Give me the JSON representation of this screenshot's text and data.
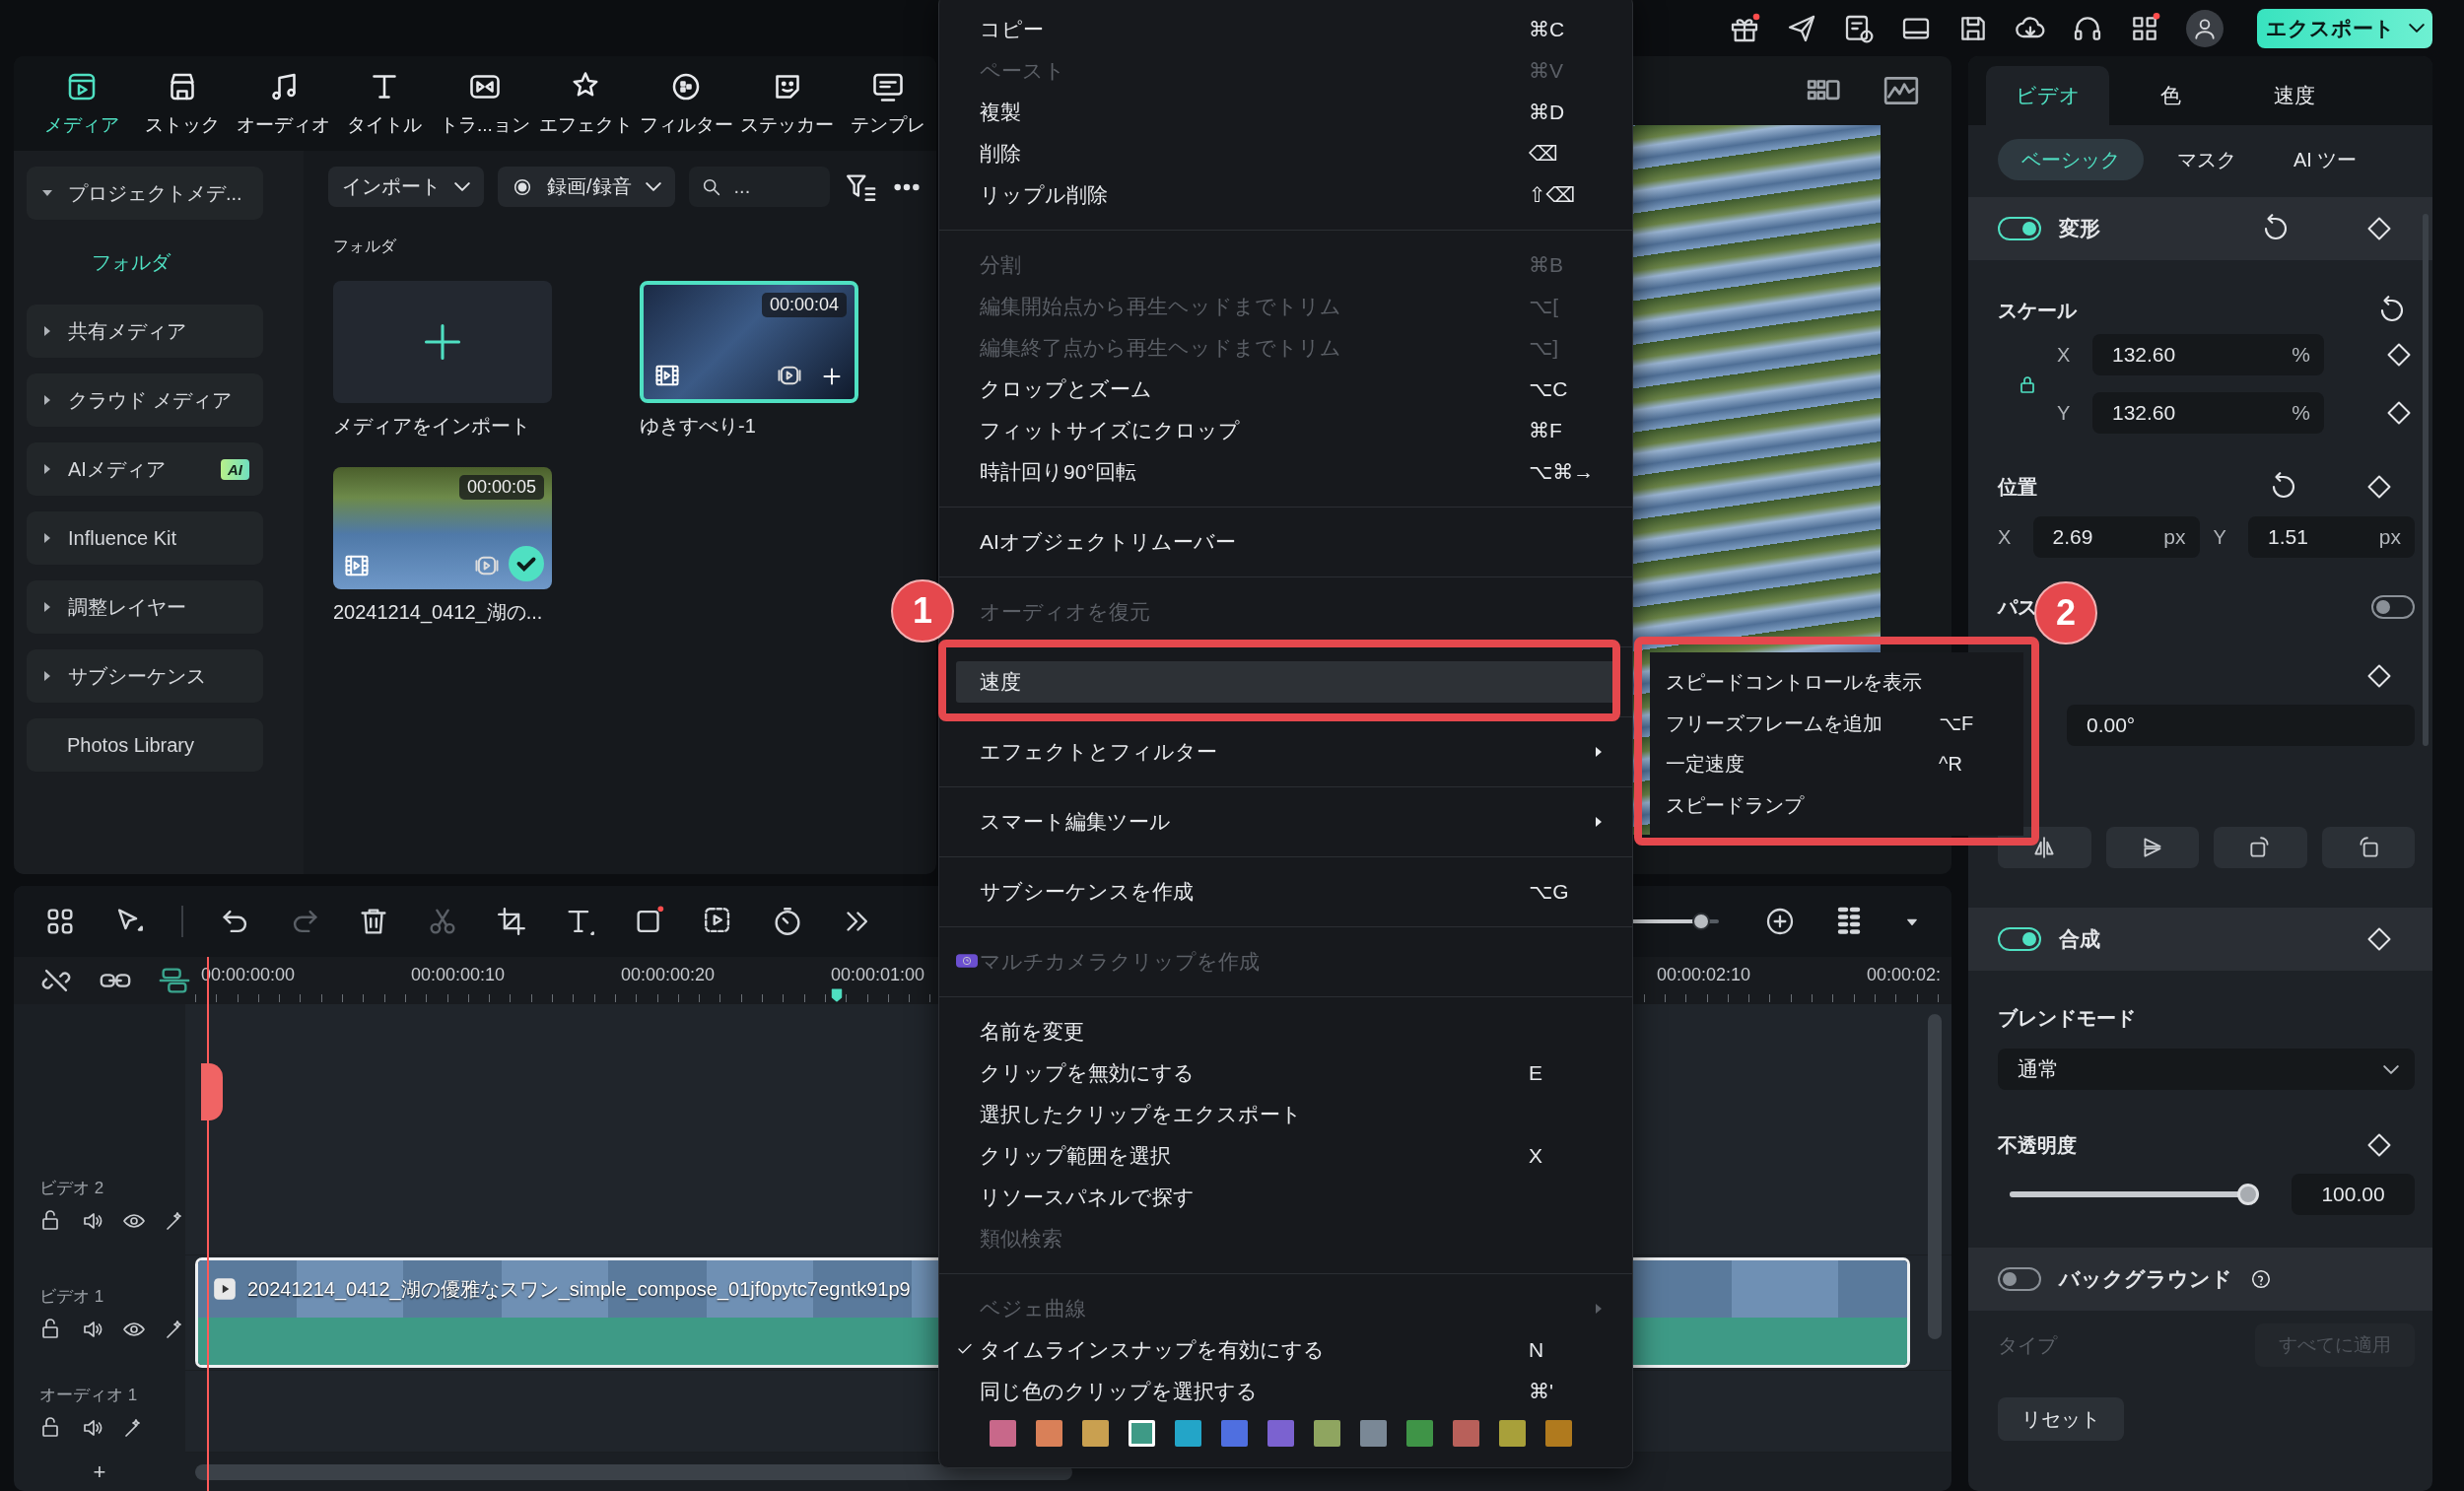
{
  "topbar": {
    "export_label": "エクスポート"
  },
  "media_tabs": [
    {
      "label": "メディア",
      "selected": true
    },
    {
      "label": "ストック",
      "selected": false
    },
    {
      "label": "オーディオ",
      "selected": false
    },
    {
      "label": "タイトル",
      "selected": false
    },
    {
      "label": "トラ...ョン",
      "selected": false
    },
    {
      "label": "エフェクト",
      "selected": false
    },
    {
      "label": "フィルター",
      "selected": false
    },
    {
      "label": "ステッカー",
      "selected": false
    },
    {
      "label": "テンプレ",
      "selected": false
    }
  ],
  "sidebar": {
    "items": [
      {
        "label": "プロジェクトメデ...",
        "kind": "expandable",
        "expanded": true,
        "selected": false,
        "children": [
          {
            "label": "フォルダ",
            "kind": "folder",
            "selected": true
          }
        ]
      },
      {
        "label": "共有メディア",
        "kind": "expandable",
        "expanded": false,
        "selected": false
      },
      {
        "label": "クラウド メディア",
        "kind": "expandable",
        "expanded": false,
        "selected": false
      },
      {
        "label": "AIメディア",
        "kind": "expandable",
        "expanded": false,
        "selected": false,
        "badge": "AI"
      },
      {
        "label": "Influence Kit",
        "kind": "expandable",
        "expanded": false,
        "selected": false
      },
      {
        "label": "調整レイヤー",
        "kind": "expandable",
        "expanded": false,
        "selected": false
      },
      {
        "label": "サブシーケンス",
        "kind": "expandable",
        "expanded": false,
        "selected": false
      },
      {
        "label": "Photos Library",
        "kind": "plain",
        "selected": false
      }
    ]
  },
  "media_toolbar": {
    "import_label": "インポート",
    "record_label": "録画/録音",
    "search_placeholder": "..."
  },
  "media": {
    "folder_label": "フォルダ",
    "items": [
      {
        "kind": "import",
        "label": "メディアをインポート",
        "selected": false
      },
      {
        "kind": "clip",
        "label": "ゆきすべり-1",
        "duration": "00:00:04",
        "selected": true,
        "used": false
      },
      {
        "kind": "clip",
        "label": "20241214_0412_湖の...",
        "duration": "00:00:05",
        "selected": false,
        "used": true
      }
    ]
  },
  "menu": {
    "groups": [
      {
        "items": [
          {
            "kind": "text",
            "label": "コピー",
            "shortcut": "⌘C",
            "disabled": false,
            "selected": false,
            "checked": false,
            "submenu": false
          },
          {
            "kind": "text",
            "label": "ペースト",
            "shortcut": "⌘V",
            "disabled": true,
            "selected": false,
            "checked": false,
            "submenu": false
          },
          {
            "kind": "text",
            "label": "複製",
            "shortcut": "⌘D",
            "disabled": false,
            "selected": false,
            "checked": false,
            "submenu": false
          },
          {
            "kind": "text",
            "label": "削除",
            "shortcut": "⌫",
            "disabled": false,
            "selected": false,
            "checked": false,
            "submenu": false
          },
          {
            "kind": "text",
            "label": "リップル削除",
            "shortcut": "⇧⌫",
            "disabled": false,
            "selected": false,
            "checked": false,
            "submenu": false
          }
        ]
      },
      {
        "items": [
          {
            "kind": "text",
            "label": "分割",
            "shortcut": "⌘B",
            "disabled": true,
            "selected": false,
            "checked": false,
            "submenu": false
          },
          {
            "kind": "text",
            "label": "編集開始点から再生ヘッドまでトリム",
            "shortcut": "⌥[",
            "disabled": true,
            "selected": false,
            "checked": false,
            "submenu": false
          },
          {
            "kind": "text",
            "label": "編集終了点から再生ヘッドまでトリム",
            "shortcut": "⌥]",
            "disabled": true,
            "selected": false,
            "checked": false,
            "submenu": false
          },
          {
            "kind": "text",
            "label": "クロップとズーム",
            "shortcut": "⌥C",
            "disabled": false,
            "selected": false,
            "checked": false,
            "submenu": false
          },
          {
            "kind": "text",
            "label": "フィットサイズにクロップ",
            "shortcut": "⌘F",
            "disabled": false,
            "selected": false,
            "checked": false,
            "submenu": false
          },
          {
            "kind": "text",
            "label": "時計回り90°回転",
            "shortcut": "⌥⌘→",
            "disabled": false,
            "selected": false,
            "checked": false,
            "submenu": false
          }
        ]
      },
      {
        "items": [
          {
            "kind": "text",
            "label": "AIオブジェクトリムーバー",
            "disabled": false,
            "selected": false,
            "checked": false,
            "submenu": false
          }
        ]
      },
      {
        "items": [
          {
            "kind": "text",
            "label": "オーディオを復元",
            "disabled": true,
            "selected": false,
            "checked": false,
            "submenu": false
          }
        ]
      },
      {
        "items": [
          {
            "kind": "text",
            "label": "速度",
            "disabled": false,
            "selected": true,
            "checked": false,
            "submenu": false
          }
        ]
      },
      {
        "items": [
          {
            "kind": "text",
            "label": "エフェクトとフィルター",
            "disabled": false,
            "selected": false,
            "checked": false,
            "submenu": true
          }
        ]
      },
      {
        "items": [
          {
            "kind": "text",
            "label": "スマート編集ツール",
            "disabled": false,
            "selected": false,
            "checked": false,
            "submenu": true
          }
        ]
      },
      {
        "items": [
          {
            "kind": "text",
            "label": "サブシーケンスを作成",
            "shortcut": "⌥G",
            "disabled": false,
            "selected": false,
            "checked": false,
            "submenu": false
          }
        ]
      },
      {
        "items": [
          {
            "kind": "camera",
            "label": "マルチカメラクリップを作成",
            "disabled": true,
            "selected": false,
            "checked": false,
            "submenu": false
          }
        ]
      },
      {
        "items": [
          {
            "kind": "text",
            "label": "名前を変更",
            "disabled": false,
            "selected": false,
            "checked": false,
            "submenu": false
          },
          {
            "kind": "text",
            "label": "クリップを無効にする",
            "shortcut": "E",
            "disabled": false,
            "selected": false,
            "checked": false,
            "submenu": false
          },
          {
            "kind": "text",
            "label": "選択したクリップをエクスポート",
            "disabled": false,
            "selected": false,
            "checked": false,
            "submenu": false
          },
          {
            "kind": "text",
            "label": "クリップ範囲を選択",
            "shortcut": "X",
            "disabled": false,
            "selected": false,
            "checked": false,
            "submenu": false
          },
          {
            "kind": "text",
            "label": "リソースパネルで探す",
            "disabled": false,
            "selected": false,
            "checked": false,
            "submenu": false
          },
          {
            "kind": "text",
            "label": "類似検索",
            "disabled": true,
            "selected": false,
            "checked": false,
            "submenu": false
          }
        ]
      },
      {
        "items": [
          {
            "kind": "text",
            "label": "ベジェ曲線",
            "disabled": true,
            "selected": false,
            "checked": false,
            "submenu": true
          },
          {
            "kind": "text",
            "label": "タイムラインスナップを有効にする",
            "shortcut": "N",
            "disabled": false,
            "selected": false,
            "checked": true,
            "submenu": false
          },
          {
            "kind": "text",
            "label": "同じ色のクリップを選択する",
            "shortcut": "⌘'",
            "disabled": false,
            "selected": false,
            "checked": false,
            "submenu": false
          }
        ]
      }
    ],
    "colors": [
      {
        "color": "#c8688a",
        "selected": false
      },
      {
        "color": "#d98058",
        "selected": false
      },
      {
        "color": "#c9a050",
        "selected": false
      },
      {
        "color": "#3e9a86",
        "selected": true
      },
      {
        "color": "#23a5c8",
        "selected": false
      },
      {
        "color": "#4f6fe0",
        "selected": false
      },
      {
        "color": "#7b62d0",
        "selected": false
      },
      {
        "color": "#8fa560",
        "selected": false
      },
      {
        "color": "#7a8896",
        "selected": false
      },
      {
        "color": "#3f9447",
        "selected": false
      },
      {
        "color": "#b8605a",
        "selected": false
      },
      {
        "color": "#a8a03a",
        "selected": false
      },
      {
        "color": "#b07a1e",
        "selected": false
      }
    ]
  },
  "submenu": {
    "items": [
      {
        "label": "スピードコントロールを表示"
      },
      {
        "label": "フリーズフレームを追加",
        "shortcut": "⌥F"
      },
      {
        "label": "一定速度",
        "shortcut": "^R"
      },
      {
        "label": "スピードランプ"
      }
    ]
  },
  "annotations": [
    {
      "number": "1"
    },
    {
      "number": "2"
    }
  ],
  "timeline": {
    "tools": [
      {
        "kind": "grid",
        "disabled": false
      },
      {
        "kind": "pointer",
        "disabled": false
      },
      {
        "kind": "undo",
        "disabled": false
      },
      {
        "kind": "redo",
        "disabled": true
      },
      {
        "kind": "trash",
        "disabled": false
      },
      {
        "kind": "scissors",
        "disabled": true
      },
      {
        "kind": "crop",
        "disabled": false
      },
      {
        "kind": "text",
        "disabled": false
      },
      {
        "kind": "rectangle",
        "disabled": false
      },
      {
        "kind": "sticker",
        "disabled": false
      },
      {
        "kind": "speed",
        "disabled": false
      },
      {
        "kind": "more",
        "disabled": false
      }
    ],
    "zoom": {
      "level": 0.85
    },
    "ruler": [
      {
        "label": "00:00:00:00"
      },
      {
        "label": "00:00:00:10"
      },
      {
        "label": "00:00:00:20"
      },
      {
        "label": "00:00:01:00"
      },
      {
        "label": "00:00:02:10"
      },
      {
        "label": "00:00:02:"
      }
    ],
    "tracks": [
      {
        "name": "ビデオ 2",
        "kind": "video"
      },
      {
        "name": "ビデオ 1",
        "kind": "video",
        "clip": "20241214_0412_湖の優雅なスワン_simple_compose_01jf0pytc7egntk91p9"
      },
      {
        "name": "オーディオ 1",
        "kind": "audio"
      }
    ],
    "add_label": "+"
  },
  "inspector": {
    "tabs": [
      {
        "label": "ビデオ",
        "selected": true
      },
      {
        "label": "色",
        "selected": false
      },
      {
        "label": "速度",
        "selected": false
      }
    ],
    "subtabs": [
      {
        "label": "ベーシック",
        "selected": true
      },
      {
        "label": "マスク",
        "selected": false
      },
      {
        "label": "AI ツー",
        "selected": false
      }
    ],
    "transform": {
      "title": "変形",
      "on": true,
      "scale_label": "スケール",
      "scale": [
        {
          "axis": "X",
          "value": "132.60",
          "unit": "%"
        },
        {
          "axis": "Y",
          "value": "132.60",
          "unit": "%"
        }
      ],
      "position_label": "位置",
      "position": [
        {
          "axis": "X",
          "value": "2.69",
          "unit": "px"
        },
        {
          "axis": "Y",
          "value": "1.51",
          "unit": "px"
        }
      ],
      "path_label": "パス",
      "path_on": false,
      "rotation": "0.00°"
    },
    "compositing": {
      "title": "合成",
      "on": true,
      "blend_label": "ブレンドモード",
      "blend_value": "通常",
      "opacity_label": "不透明度",
      "opacity": {
        "level": 1,
        "value": "100.00"
      }
    },
    "background": {
      "title": "バックグラウンド",
      "on": false,
      "type_label": "タイプ",
      "apply_all": "すべてに適用"
    },
    "reset_label": "リセット"
  }
}
